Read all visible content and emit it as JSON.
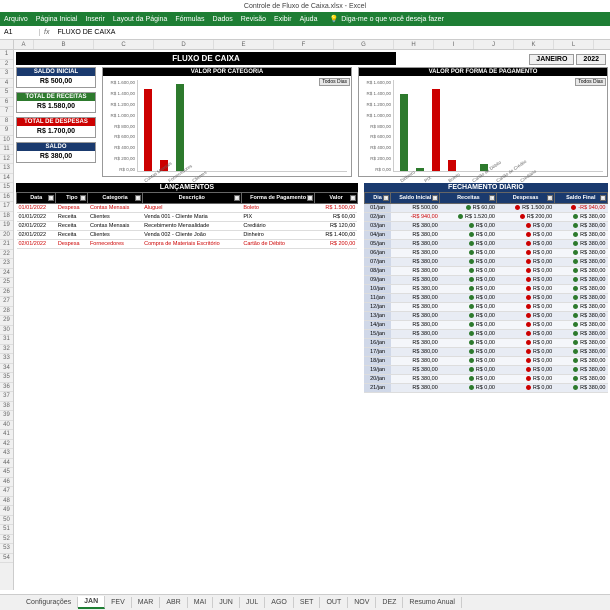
{
  "window": {
    "title": "Controle de Fluxo de Caixa.xlsx - Excel"
  },
  "ribbon": {
    "tabs": [
      "Arquivo",
      "Página Inicial",
      "Inserir",
      "Layout da Página",
      "Fórmulas",
      "Dados",
      "Revisão",
      "Exibir",
      "Ajuda"
    ],
    "tellme": "Diga-me o que você deseja fazer"
  },
  "formula_bar": {
    "cell": "A1",
    "fx": "fx",
    "value": "FLUXO DE CAIXA"
  },
  "columns": [
    "A",
    "B",
    "C",
    "D",
    "E",
    "F",
    "G",
    "H",
    "I",
    "J",
    "K",
    "L"
  ],
  "title": "FLUXO DE CAIXA",
  "month": "JANEIRO",
  "year": "2022",
  "summary": {
    "saldo_inicial": {
      "label": "SALDO INICIAL",
      "value": "R$ 500,00"
    },
    "total_receitas": {
      "label": "TOTAL DE RECEITAS",
      "value": "R$ 1.580,00"
    },
    "total_despesas": {
      "label": "TOTAL DE DESPESAS",
      "value": "R$ 1.700,00"
    },
    "saldo": {
      "label": "SALDO",
      "value": "R$ 380,00"
    }
  },
  "chart1": {
    "title": "VALOR POR CATEGORIA",
    "filter": "Todos Dias"
  },
  "chart2": {
    "title": "VALOR POR FORMA DE PAGAMENTO",
    "filter": "Todos Dias"
  },
  "chart_data": [
    {
      "type": "bar",
      "title": "VALOR POR CATEGORIA",
      "ylabel": "",
      "ylim": [
        0,
        1600
      ],
      "yticks": [
        "R$ 1.600,00",
        "R$ 1.400,00",
        "R$ 1.200,00",
        "R$ 1.000,00",
        "R$ 800,00",
        "R$ 600,00",
        "R$ 400,00",
        "R$ 200,00",
        "R$ 0,00"
      ],
      "categories": [
        "Contas Mensais",
        "Fornecedores",
        "Clientes"
      ],
      "series": [
        {
          "name": "valor",
          "values": [
            1500,
            200,
            1580
          ],
          "colors": [
            "red",
            "red",
            "green"
          ]
        }
      ]
    },
    {
      "type": "bar",
      "title": "VALOR POR FORMA DE PAGAMENTO",
      "ylabel": "",
      "ylim": [
        0,
        1600
      ],
      "yticks": [
        "R$ 1.600,00",
        "R$ 1.400,00",
        "R$ 1.200,00",
        "R$ 1.000,00",
        "R$ 800,00",
        "R$ 600,00",
        "R$ 400,00",
        "R$ 200,00",
        "R$ 0,00"
      ],
      "categories": [
        "Dinheiro",
        "PIX",
        "Boleto",
        "Cartão de Débito",
        "Cartão de Crédito",
        "Crediário"
      ],
      "series": [
        {
          "name": "valor",
          "values": [
            1400,
            60,
            1500,
            200,
            0,
            120
          ],
          "colors": [
            "green",
            "green",
            "red",
            "red",
            "green",
            "green"
          ]
        }
      ]
    }
  ],
  "lancamentos": {
    "title": "LANÇAMENTOS",
    "headers": [
      "Data",
      "Tipo",
      "Categoria",
      "Descrição",
      "Forma de Pagamento",
      "Valor"
    ],
    "rows": [
      {
        "cls": "despesa",
        "c": [
          "01/01/2022",
          "Despesa",
          "Contas Mensais",
          "Aluguel",
          "Boleto",
          "R$ 1.500,00"
        ]
      },
      {
        "cls": "",
        "c": [
          "01/01/2022",
          "Receita",
          "Clientes",
          "Venda 001 - Cliente Maria",
          "PIX",
          "R$ 60,00"
        ]
      },
      {
        "cls": "",
        "c": [
          "02/01/2022",
          "Receita",
          "Contas Mensais",
          "Recebimento Mensalidade",
          "Crediário",
          "R$ 120,00"
        ]
      },
      {
        "cls": "",
        "c": [
          "02/01/2022",
          "Receita",
          "Clientes",
          "Venda 002 - Cliente João",
          "Dinheiro",
          "R$ 1.400,00"
        ]
      },
      {
        "cls": "despesa",
        "c": [
          "02/01/2022",
          "Despesa",
          "Fornecedores",
          "Compra de Materiais Escritório",
          "Cartão de Débito",
          "R$ 200,00"
        ]
      }
    ]
  },
  "fechamento": {
    "title": "FECHAMENTO DIÁRIO",
    "headers": [
      "Dia",
      "Saldo Inicial",
      "Receitas",
      "Despesas",
      "Saldo Final"
    ],
    "rows": [
      {
        "dia": "01/jan",
        "si": "R$ 500,00",
        "rec": "R$ 60,00",
        "desp": "R$ 1.500,00",
        "sf": "-R$ 940,00",
        "sfneg": true
      },
      {
        "dia": "02/jan",
        "si": "-R$ 940,00",
        "sineg": true,
        "rec": "R$ 1.520,00",
        "desp": "R$ 200,00",
        "sf": "R$ 380,00"
      },
      {
        "dia": "03/jan",
        "si": "R$ 380,00",
        "rec": "R$ 0,00",
        "desp": "R$ 0,00",
        "sf": "R$ 380,00"
      },
      {
        "dia": "04/jan",
        "si": "R$ 380,00",
        "rec": "R$ 0,00",
        "desp": "R$ 0,00",
        "sf": "R$ 380,00"
      },
      {
        "dia": "05/jan",
        "si": "R$ 380,00",
        "rec": "R$ 0,00",
        "desp": "R$ 0,00",
        "sf": "R$ 380,00"
      },
      {
        "dia": "06/jan",
        "si": "R$ 380,00",
        "rec": "R$ 0,00",
        "desp": "R$ 0,00",
        "sf": "R$ 380,00"
      },
      {
        "dia": "07/jan",
        "si": "R$ 380,00",
        "rec": "R$ 0,00",
        "desp": "R$ 0,00",
        "sf": "R$ 380,00"
      },
      {
        "dia": "08/jan",
        "si": "R$ 380,00",
        "rec": "R$ 0,00",
        "desp": "R$ 0,00",
        "sf": "R$ 380,00"
      },
      {
        "dia": "09/jan",
        "si": "R$ 380,00",
        "rec": "R$ 0,00",
        "desp": "R$ 0,00",
        "sf": "R$ 380,00"
      },
      {
        "dia": "10/jan",
        "si": "R$ 380,00",
        "rec": "R$ 0,00",
        "desp": "R$ 0,00",
        "sf": "R$ 380,00"
      },
      {
        "dia": "11/jan",
        "si": "R$ 380,00",
        "rec": "R$ 0,00",
        "desp": "R$ 0,00",
        "sf": "R$ 380,00"
      },
      {
        "dia": "12/jan",
        "si": "R$ 380,00",
        "rec": "R$ 0,00",
        "desp": "R$ 0,00",
        "sf": "R$ 380,00"
      },
      {
        "dia": "13/jan",
        "si": "R$ 380,00",
        "rec": "R$ 0,00",
        "desp": "R$ 0,00",
        "sf": "R$ 380,00"
      },
      {
        "dia": "14/jan",
        "si": "R$ 380,00",
        "rec": "R$ 0,00",
        "desp": "R$ 0,00",
        "sf": "R$ 380,00"
      },
      {
        "dia": "15/jan",
        "si": "R$ 380,00",
        "rec": "R$ 0,00",
        "desp": "R$ 0,00",
        "sf": "R$ 380,00"
      },
      {
        "dia": "16/jan",
        "si": "R$ 380,00",
        "rec": "R$ 0,00",
        "desp": "R$ 0,00",
        "sf": "R$ 380,00"
      },
      {
        "dia": "17/jan",
        "si": "R$ 380,00",
        "rec": "R$ 0,00",
        "desp": "R$ 0,00",
        "sf": "R$ 380,00"
      },
      {
        "dia": "18/jan",
        "si": "R$ 380,00",
        "rec": "R$ 0,00",
        "desp": "R$ 0,00",
        "sf": "R$ 380,00"
      },
      {
        "dia": "19/jan",
        "si": "R$ 380,00",
        "rec": "R$ 0,00",
        "desp": "R$ 0,00",
        "sf": "R$ 380,00"
      },
      {
        "dia": "20/jan",
        "si": "R$ 380,00",
        "rec": "R$ 0,00",
        "desp": "R$ 0,00",
        "sf": "R$ 380,00"
      },
      {
        "dia": "21/jan",
        "si": "R$ 380,00",
        "rec": "R$ 0,00",
        "desp": "R$ 0,00",
        "sf": "R$ 380,00"
      }
    ]
  },
  "sheet_tabs": [
    "Configurações",
    "JAN",
    "FEV",
    "MAR",
    "ABR",
    "MAI",
    "JUN",
    "JUL",
    "AGO",
    "SET",
    "OUT",
    "NOV",
    "DEZ",
    "Resumo Anual"
  ],
  "active_tab": "JAN"
}
